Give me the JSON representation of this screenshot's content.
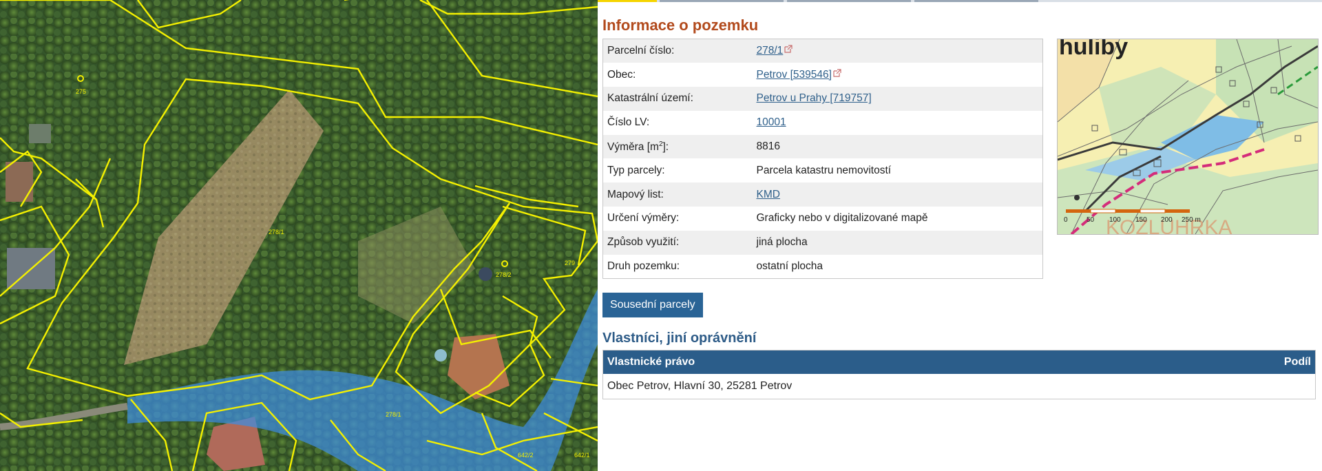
{
  "info": {
    "title": "Informace o pozemku",
    "rows": [
      {
        "label": "Parcelní číslo:",
        "value": "278/1",
        "link": true,
        "external": true
      },
      {
        "label": "Obec:",
        "value": "Petrov [539546]",
        "link": true,
        "external": true
      },
      {
        "label": "Katastrální území:",
        "value": "Petrov u Prahy [719757]",
        "link": true,
        "external": false
      },
      {
        "label": "Číslo LV:",
        "value": "10001",
        "link": true,
        "external": false
      },
      {
        "label": "Výměra [m",
        "label_sup": "2",
        "label_suffix": "]:",
        "value": "8816",
        "link": false,
        "external": false
      },
      {
        "label": "Typ parcely:",
        "value": "Parcela katastru nemovitostí",
        "link": false,
        "external": false
      },
      {
        "label": "Mapový list:",
        "value": "KMD",
        "link": true,
        "external": false
      },
      {
        "label": "Určení výměry:",
        "value": "Graficky nebo v digitalizované mapě",
        "link": false,
        "external": false
      },
      {
        "label": "Způsob využití:",
        "value": "jiná plocha",
        "link": false,
        "external": false
      },
      {
        "label": "Druh pozemku:",
        "value": "ostatní plocha",
        "link": false,
        "external": false
      }
    ]
  },
  "neighbors_button": "Sousední parcely",
  "owners": {
    "title": "Vlastníci, jiní oprávnění",
    "col_right": "Vlastnické právo",
    "col_share": "Podíl",
    "rows": [
      {
        "owner": "Obec Petrov, Hlavní 30, 25281 Petrov",
        "share": ""
      }
    ]
  },
  "aerial_map": {
    "parcel_labels": [
      "278/1",
      "278/2",
      "278/1",
      "275",
      "642/2",
      "642/1",
      "279"
    ]
  },
  "thumb_map": {
    "place_name": "huliby",
    "place_name_bottom": "KOZLUHRKA",
    "scale_labels": [
      "0",
      "50",
      "100",
      "150",
      "200",
      "250 m"
    ]
  },
  "colors": {
    "title_orange": "#b24a1c",
    "title_blue": "#2d5b87",
    "button_bg": "#2a6496",
    "table_header_bg": "#2b5d8a",
    "link": "#2e5f8a",
    "parcel_outline": "#f4f000",
    "water_overlay": "#3f8ee0"
  }
}
